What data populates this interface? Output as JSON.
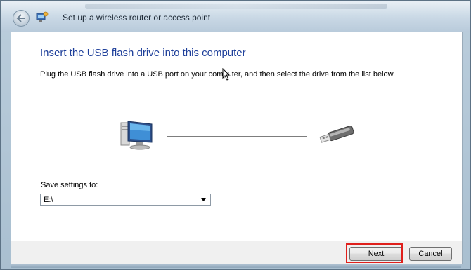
{
  "window": {
    "title": "Set up a wireless router or access point",
    "back_button_icon": "back-arrow-icon",
    "wizard_icon": "network-wizard-icon"
  },
  "page": {
    "heading": "Insert the USB flash drive into this computer",
    "description": "Plug the USB flash drive into a USB port on your computer, and then select the drive from the list below.",
    "illustration": {
      "left_icon": "computer-icon",
      "right_icon": "usb-flash-drive-icon"
    },
    "save_settings": {
      "label": "Save settings to:",
      "selected_value": "E:\\"
    }
  },
  "footer": {
    "next_label": "Next",
    "cancel_label": "Cancel",
    "highlight_color": "#e0201c"
  },
  "colors": {
    "heading": "#1e3f9a",
    "content_bg": "#ffffff",
    "footer_bg": "#f0f0f0"
  }
}
